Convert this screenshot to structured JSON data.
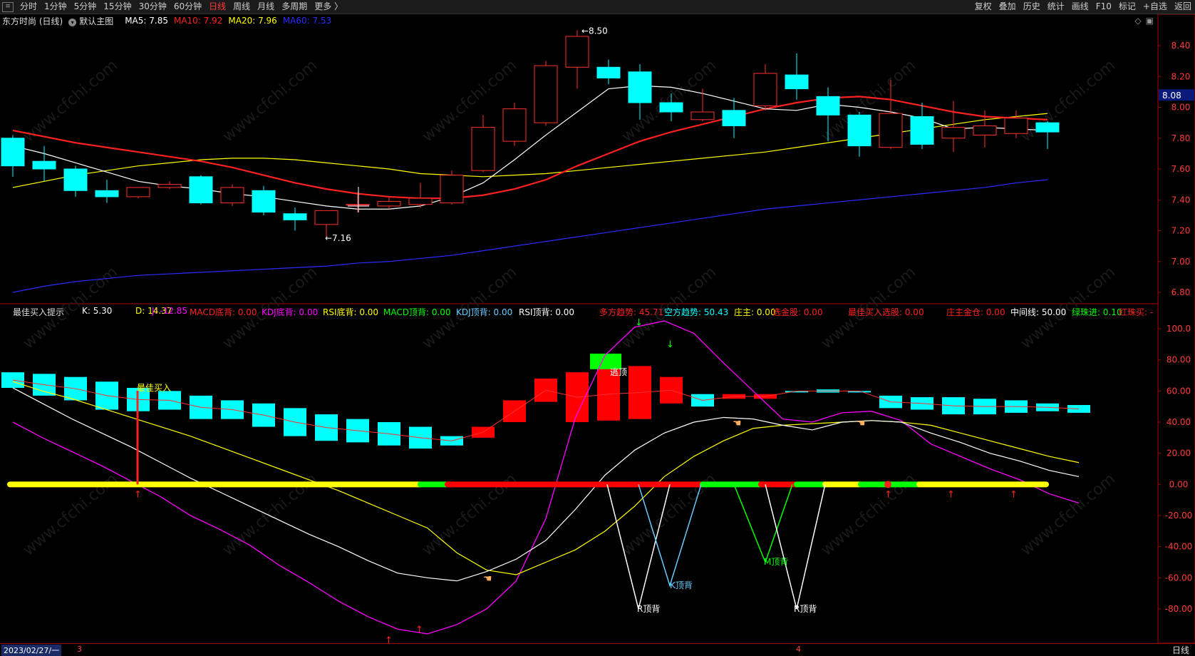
{
  "toolbar": {
    "periods": [
      "分时",
      "1分钟",
      "5分钟",
      "15分钟",
      "30分钟",
      "60分钟",
      "日线",
      "周线",
      "月线",
      "多周期",
      "更多 〉"
    ],
    "active_period": "日线",
    "right_buttons": [
      "复权",
      "叠加",
      "历史",
      "统计",
      "画线",
      "F10",
      "标记",
      "+自选",
      "返回"
    ]
  },
  "info": {
    "stock": "东方时尚 (日线)",
    "main_chart_label": "默认主图",
    "ma5": "MA5: 7.85",
    "ma10": "MA10: 7.92",
    "ma20": "MA20: 7.96",
    "ma60": "MA60: 7.53",
    "colors": {
      "ma5": "#ffffff",
      "ma10": "#ff2020",
      "ma20": "#ffff00",
      "ma60": "#2b2bff"
    }
  },
  "indicator": {
    "name": "最佳买入提示",
    "items": [
      {
        "text": "K: 5.30",
        "color": "#ffffff"
      },
      {
        "text": "D: 14.37",
        "color": "#ffff00"
      },
      {
        "text": "J: -12.85",
        "color": "#ff00ff"
      },
      {
        "text": "MACD底背: 0.00",
        "color": "#ff2020"
      },
      {
        "text": "KDJ底背: 0.00",
        "color": "#ff00ff"
      },
      {
        "text": "RSI底背: 0.00",
        "color": "#ffff00"
      },
      {
        "text": "MACD顶背: 0.00",
        "color": "#00ff00"
      },
      {
        "text": "KDJ顶背: 0.00",
        "color": "#66ccff"
      },
      {
        "text": "RSI顶背: 0.00",
        "color": "#ffffff"
      },
      {
        "text": "多方趋势: 45.71",
        "color": "#ff2020"
      },
      {
        "text": "空方趋势: 50.43",
        "color": "#00ffff"
      },
      {
        "text": "庄主: 0.00",
        "color": "#ffff00"
      },
      {
        "text": "选金股: 0.00",
        "color": "#ff2020"
      },
      {
        "text": "最佳买入选股: 0.00",
        "color": "#ff2020"
      },
      {
        "text": "庄主金仓: 0.00",
        "color": "#ff2020"
      },
      {
        "text": "中间线: 50.00",
        "color": "#ffffff"
      },
      {
        "text": "绿珠进: 0.10",
        "color": "#00ff00"
      },
      {
        "text": "红珠买: -",
        "color": "#ff2020"
      }
    ]
  },
  "price_axis": [
    "8.40",
    "8.20",
    "8.00",
    "7.80",
    "7.60",
    "7.40",
    "7.20",
    "7.00",
    "6.80"
  ],
  "current_price": "8.08",
  "indicator_axis": [
    "100.0",
    "80.00",
    "60.00",
    "40.00",
    "20.00",
    "0.00",
    "-20.00",
    "-40.00",
    "-60.00",
    "-80.00"
  ],
  "annotations": {
    "high": "8.50",
    "low": "7.16",
    "best_buy": "最佳买入",
    "escape_top": "逃顶",
    "k_top_div": "K顶背",
    "r_top_div_1": "R顶背",
    "m_top_div": "M顶背",
    "r_top_div_2": "R顶背"
  },
  "footer": {
    "date": "2023/02/27/一",
    "month_3": "3",
    "month_4": "4",
    "period": "日线"
  },
  "chart_data": {
    "type": "candlestick",
    "candles": [
      {
        "o": 7.8,
        "h": 7.82,
        "c": 7.62,
        "l": 7.55
      },
      {
        "o": 7.65,
        "h": 7.75,
        "c": 7.6,
        "l": 7.52
      },
      {
        "o": 7.6,
        "h": 7.62,
        "c": 7.46,
        "l": 7.42
      },
      {
        "o": 7.46,
        "h": 7.53,
        "c": 7.42,
        "l": 7.38
      },
      {
        "o": 7.42,
        "h": 7.48,
        "c": 7.48,
        "l": 7.41
      },
      {
        "o": 7.48,
        "h": 7.52,
        "c": 7.5,
        "l": 7.47
      },
      {
        "o": 7.55,
        "h": 7.56,
        "c": 7.38,
        "l": 7.37
      },
      {
        "o": 7.38,
        "h": 7.5,
        "c": 7.48,
        "l": 7.36
      },
      {
        "o": 7.46,
        "h": 7.49,
        "c": 7.32,
        "l": 7.3
      },
      {
        "o": 7.31,
        "h": 7.35,
        "c": 7.27,
        "l": 7.2
      },
      {
        "o": 7.24,
        "h": 7.33,
        "c": 7.33,
        "l": 7.16
      },
      {
        "o": 7.37,
        "h": 7.45,
        "c": 7.37,
        "l": 7.32
      },
      {
        "o": 7.36,
        "h": 7.42,
        "c": 7.39,
        "l": 7.34
      },
      {
        "o": 7.37,
        "h": 7.51,
        "c": 7.41,
        "l": 7.35
      },
      {
        "o": 7.38,
        "h": 7.59,
        "c": 7.56,
        "l": 7.37
      },
      {
        "o": 7.59,
        "h": 7.95,
        "c": 7.87,
        "l": 7.58
      },
      {
        "o": 7.78,
        "h": 8.03,
        "c": 7.99,
        "l": 7.75
      },
      {
        "o": 7.9,
        "h": 8.3,
        "c": 8.27,
        "l": 7.88
      },
      {
        "o": 8.26,
        "h": 8.5,
        "c": 8.46,
        "l": 8.12
      },
      {
        "o": 8.26,
        "h": 8.31,
        "c": 8.19,
        "l": 8.15
      },
      {
        "o": 8.23,
        "h": 8.28,
        "c": 8.03,
        "l": 7.92
      },
      {
        "o": 8.03,
        "h": 8.09,
        "c": 7.97,
        "l": 7.91
      },
      {
        "o": 7.92,
        "h": 8.12,
        "c": 7.97,
        "l": 7.91
      },
      {
        "o": 7.98,
        "h": 8.06,
        "c": 7.88,
        "l": 7.8
      },
      {
        "o": 8.01,
        "h": 8.28,
        "c": 8.22,
        "l": 7.98
      },
      {
        "o": 8.21,
        "h": 8.35,
        "c": 8.12,
        "l": 8.05
      },
      {
        "o": 8.07,
        "h": 8.13,
        "c": 7.95,
        "l": 7.78
      },
      {
        "o": 7.95,
        "h": 7.97,
        "c": 7.75,
        "l": 7.68
      },
      {
        "o": 7.74,
        "h": 8.18,
        "c": 7.96,
        "l": 7.73
      },
      {
        "o": 7.94,
        "h": 8.03,
        "c": 7.76,
        "l": 7.73
      },
      {
        "o": 7.8,
        "h": 8.04,
        "c": 7.87,
        "l": 7.71
      },
      {
        "o": 7.82,
        "h": 7.98,
        "c": 7.88,
        "l": 7.74
      },
      {
        "o": 7.83,
        "h": 7.98,
        "c": 7.93,
        "l": 7.8
      },
      {
        "o": 7.9,
        "h": 7.91,
        "c": 7.84,
        "l": 7.73
      }
    ],
    "ma5": [
      7.75,
      7.7,
      7.64,
      7.58,
      7.52,
      7.49,
      7.47,
      7.44,
      7.42,
      7.39,
      7.36,
      7.34,
      7.34,
      7.36,
      7.42,
      7.51,
      7.66,
      7.82,
      7.97,
      8.12,
      8.14,
      8.13,
      8.09,
      8.04,
      7.99,
      7.98,
      8.02,
      8.0,
      7.97,
      7.93,
      7.86,
      7.87,
      7.86,
      7.85
    ],
    "ma10": [
      7.85,
      7.81,
      7.77,
      7.74,
      7.71,
      7.68,
      7.65,
      7.61,
      7.56,
      7.51,
      7.47,
      7.44,
      7.42,
      7.41,
      7.41,
      7.43,
      7.47,
      7.53,
      7.62,
      7.7,
      7.78,
      7.84,
      7.89,
      7.94,
      7.99,
      8.03,
      8.06,
      8.07,
      8.05,
      8.01,
      7.97,
      7.94,
      7.93,
      7.92
    ],
    "ma20": [
      7.48,
      7.52,
      7.56,
      7.59,
      7.62,
      7.64,
      7.66,
      7.67,
      7.67,
      7.66,
      7.64,
      7.62,
      7.6,
      7.57,
      7.56,
      7.55,
      7.56,
      7.57,
      7.59,
      7.61,
      7.63,
      7.65,
      7.67,
      7.69,
      7.71,
      7.74,
      7.77,
      7.8,
      7.83,
      7.86,
      7.89,
      7.92,
      7.94,
      7.96
    ],
    "ma60": [
      6.8,
      6.84,
      6.87,
      6.89,
      6.91,
      6.92,
      6.93,
      6.94,
      6.95,
      6.96,
      6.97,
      6.99,
      7.0,
      7.02,
      7.04,
      7.07,
      7.1,
      7.13,
      7.16,
      7.19,
      7.22,
      7.25,
      7.28,
      7.31,
      7.34,
      7.36,
      7.38,
      7.4,
      7.42,
      7.44,
      7.46,
      7.48,
      7.51,
      7.53
    ],
    "indicator": {
      "k": [
        62,
        52,
        42,
        33,
        24,
        14,
        4,
        -5,
        -14,
        -23,
        -32,
        -40,
        -49,
        -57,
        -60,
        -62,
        -56,
        -48,
        -36,
        -16,
        6,
        22,
        33,
        40,
        43,
        42,
        38,
        35,
        40,
        41,
        40,
        33,
        27,
        20,
        15,
        9,
        5
      ],
      "d": [
        66,
        60,
        55,
        49,
        43,
        37,
        31,
        24,
        17,
        10,
        3,
        -4,
        -12,
        -20,
        -28,
        -44,
        -55,
        -58,
        -50,
        -42,
        -30,
        -14,
        5,
        18,
        28,
        36,
        38,
        39,
        40,
        41,
        40,
        38,
        33,
        28,
        23,
        18,
        14
      ],
      "j": [
        40,
        30,
        21,
        12,
        2,
        -8,
        -20,
        -29,
        -39,
        -52,
        -63,
        -75,
        -85,
        -93,
        -96,
        -90,
        -80,
        -62,
        -22,
        43,
        83,
        101,
        105,
        97,
        78,
        60,
        42,
        40,
        46,
        47,
        41,
        26,
        18,
        10,
        3,
        -6,
        -12
      ],
      "trend_bars": [
        [
          72,
          62
        ],
        [
          71,
          57
        ],
        [
          69,
          54
        ],
        [
          66,
          48
        ],
        [
          62,
          47
        ],
        [
          60,
          48
        ],
        [
          57,
          42
        ],
        [
          54,
          42
        ],
        [
          52,
          37
        ],
        [
          49,
          31
        ],
        [
          45,
          28
        ],
        [
          42,
          27
        ],
        [
          40,
          25
        ],
        [
          37,
          23
        ],
        [
          31,
          25
        ],
        [
          30,
          37
        ],
        [
          40,
          54
        ],
        [
          53,
          68
        ],
        [
          72,
          40
        ],
        [
          75,
          41
        ],
        [
          76,
          42
        ],
        [
          69,
          52
        ],
        [
          58,
          50
        ],
        [
          58,
          55
        ],
        [
          58,
          55
        ],
        [
          60,
          60
        ],
        [
          61,
          59
        ],
        [
          60,
          60
        ],
        [
          57,
          49
        ],
        [
          56,
          48
        ],
        [
          56,
          45
        ],
        [
          55,
          45
        ],
        [
          54,
          46
        ],
        [
          52,
          47
        ],
        [
          51,
          46
        ]
      ],
      "trend_colors": [
        "c",
        "c",
        "c",
        "c",
        "c",
        "c",
        "c",
        "c",
        "c",
        "c",
        "c",
        "c",
        "c",
        "c",
        "c",
        "r",
        "r",
        "r",
        "r",
        "r",
        "r",
        "r",
        "c",
        "r",
        "r",
        "c",
        "c",
        "c",
        "c",
        "c",
        "c",
        "c",
        "c",
        "c",
        "c"
      ]
    }
  }
}
